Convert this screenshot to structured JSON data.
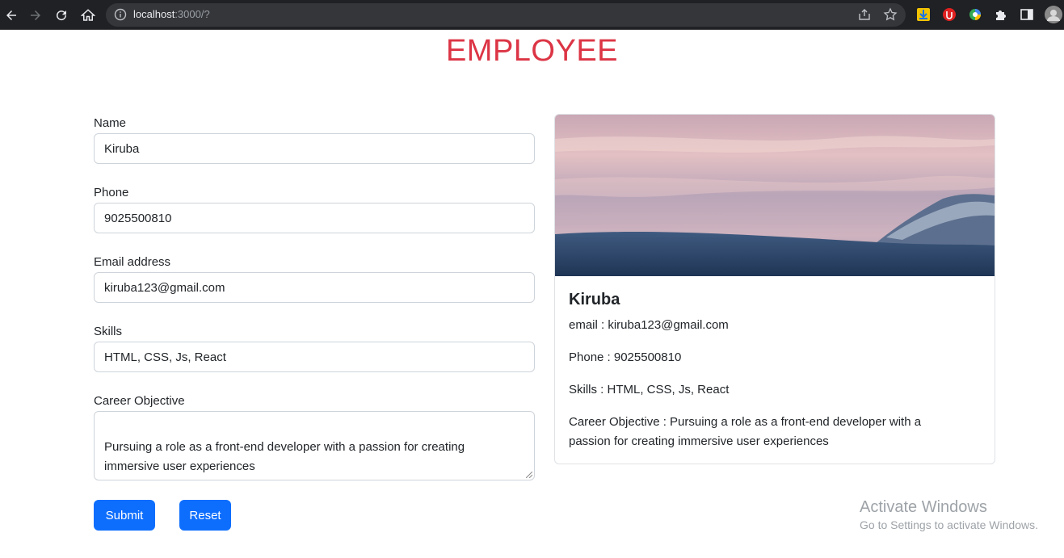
{
  "browser": {
    "url_host": "localhost",
    "url_path": ":3000/?"
  },
  "page": {
    "title": "EMPLOYEE"
  },
  "form": {
    "name_label": "Name",
    "name_value": "Kiruba",
    "phone_label": "Phone",
    "phone_value": "9025500810",
    "email_label": "Email address",
    "email_value": "kiruba123@gmail.com",
    "skills_label": "Skills",
    "skills_value": "HTML, CSS, Js, React",
    "objective_label": "Career Objective",
    "objective_line1": "Pursuing a role as a front-end developer with a passion for creating",
    "objective_line2": "immersive user experiences",
    "submit_label": "Submit",
    "reset_label": "Reset"
  },
  "card": {
    "name": "Kiruba",
    "email_line": "email : kiruba123@gmail.com",
    "phone_line": "Phone : 9025500810",
    "skills_line": "Skills : HTML, CSS, Js, React",
    "objective_line1": "Career Objective : Pursuing a role as a front-end developer with a",
    "objective_line2": "passion for creating immersive user experiences"
  },
  "watermark": {
    "title": "Activate Windows",
    "subtitle": "Go to Settings to activate Windows."
  },
  "colors": {
    "title_red": "#dc3545",
    "button_blue": "#0d6efd"
  },
  "icons": [
    "back-icon",
    "forward-icon",
    "reload-icon",
    "home-icon",
    "info-icon",
    "share-icon",
    "star-icon",
    "extension-download-icon",
    "extension-shield-icon",
    "extension-color-icon",
    "puzzle-icon",
    "sidepanel-icon",
    "profile-avatar"
  ]
}
